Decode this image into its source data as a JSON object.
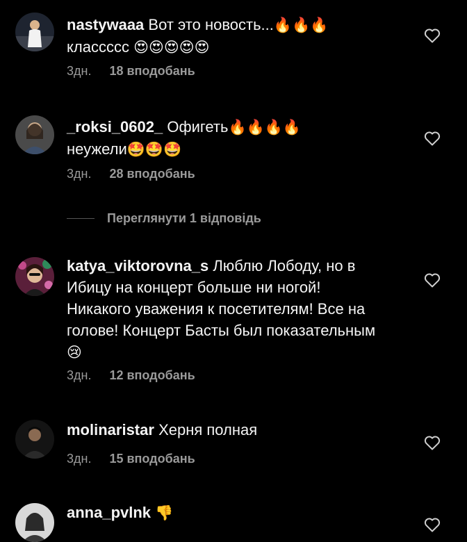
{
  "colors": {
    "background": "#000000",
    "text": "#f5f5f5",
    "muted": "#9a9a9a",
    "divider": "#555555"
  },
  "comments": [
    {
      "username": "nastywaaa",
      "text_line1": "Вот это новость...",
      "emoji_line1": "🔥🔥🔥",
      "text_line2": "классссс",
      "emoji_line2": "😍😍😍😍😍",
      "time": "3дн.",
      "likes": "18 вподобань",
      "avatar_icon": "avatar-photo-icon"
    },
    {
      "username": "_roksi_0602_",
      "text_line1": "Офигеть",
      "emoji_line1": "🔥🔥🔥🔥",
      "text_line2": "неужели",
      "emoji_line2": "🤩🤩🤩",
      "time": "3дн.",
      "likes": "28 вподобань",
      "avatar_icon": "avatar-photo-icon"
    },
    {
      "username": "katya_viktorovna_s",
      "text": "Люблю Лободу, но в Ибицу на концерт больше ни ногой! Никакого уважения к посетителям! Все на голове! Концерт Басты был показательным",
      "emoji": "😢",
      "time": "3дн.",
      "likes": "12 вподобань",
      "avatar_icon": "avatar-photo-icon"
    },
    {
      "username": "molinaristar",
      "text": "Херня полная",
      "time": "3дн.",
      "likes": "15 вподобань",
      "avatar_icon": "avatar-photo-icon"
    },
    {
      "username": "anna_pvlnk",
      "emoji": "👎",
      "avatar_icon": "avatar-photo-icon"
    }
  ],
  "replies_toggle": {
    "label": "Переглянути 1 відповідь"
  },
  "icons": {
    "like": "heart-outline-icon"
  }
}
